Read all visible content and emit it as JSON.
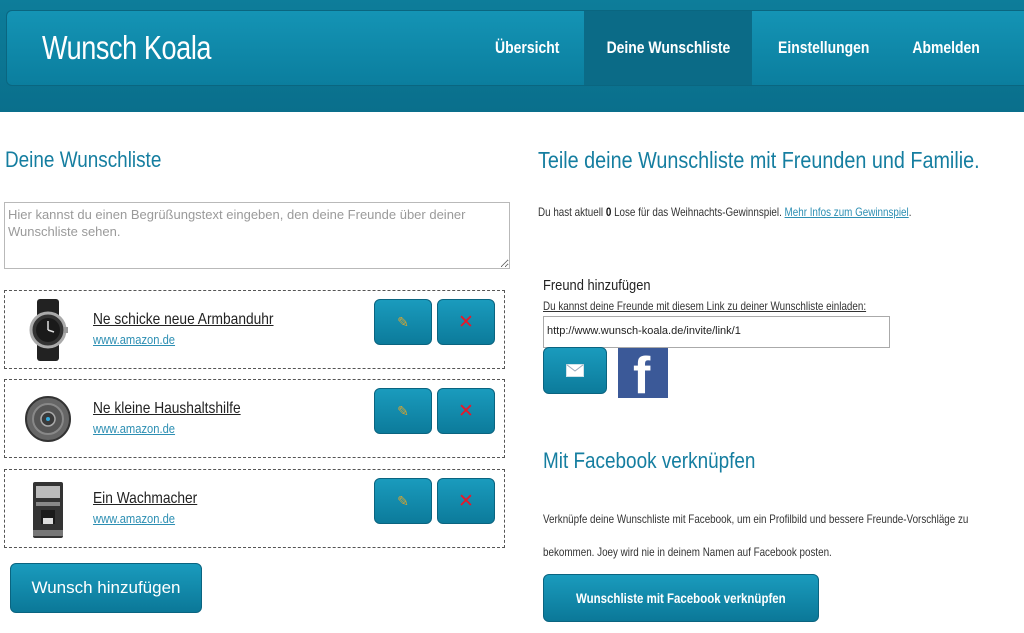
{
  "header": {
    "brand": "Wunsch Koala",
    "nav": [
      {
        "label": "Übersicht"
      },
      {
        "label": "Deine Wunschliste",
        "active": true
      },
      {
        "label": "Einstellungen"
      },
      {
        "label": "Abmelden"
      }
    ]
  },
  "wishlist": {
    "heading": "Deine Wunschliste",
    "greeting_placeholder": "Hier kannst du einen Begrüßungstext eingeben, den deine Freunde über deiner Wunschliste sehen.",
    "items": [
      {
        "title": "Ne schicke neue Armbanduhr",
        "source": "www.amazon.de",
        "image": "wristwatch"
      },
      {
        "title": "Ne kleine Haushaltshilfe",
        "source": "www.amazon.de",
        "image": "robot-vacuum"
      },
      {
        "title": "Ein Wachmacher",
        "source": "www.amazon.de",
        "image": "coffee-machine"
      }
    ],
    "edit_icon": "pencil-icon",
    "delete_icon": "x-icon",
    "add_button": "Wunsch hinzufügen"
  },
  "share": {
    "heading": "Teile deine Wunschliste mit Freunden und Familie.",
    "lottery_prefix": "Du hast aktuell",
    "lottery_count": "0",
    "lottery_suffix": "Lose für das Weihnachts-Gewinnspiel.",
    "lottery_link": "Mehr Infos zum Gewinnspiel",
    "lottery_end": ".",
    "add_friend_title": "Freund hinzufügen",
    "add_friend_hint": "Du kannst deine Freunde mit diesem Link zu deiner Wunschliste einladen:",
    "invite_link": "http://www.wunsch-koala.de/invite/link/1",
    "mail_icon": "envelope-icon",
    "facebook_icon": "facebook-icon"
  },
  "facebook": {
    "heading": "Mit Facebook verknüpfen",
    "text": "Verknüpfe deine Wunschliste mit Facebook, um ein Profilbild und bessere Freunde-Vorschläge zu bekommen. Joey wird nie in deinem Namen auf Facebook posten.",
    "button": "Wunschliste mit Facebook verknüpfen"
  },
  "colors": {
    "primary": "#1494b5",
    "heading": "#157ea0",
    "link": "#2d8fb3",
    "delete": "#e6192a",
    "facebook": "#3b5998"
  }
}
